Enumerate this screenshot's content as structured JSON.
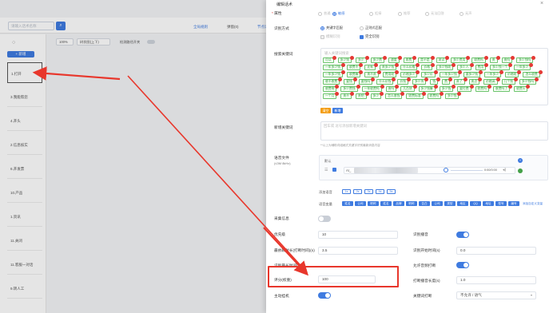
{
  "background": {
    "search_placeholder": "请输入话术名称",
    "tabs": [
      "全局规则",
      "弹窗(0)",
      "节点话术"
    ],
    "add_button": "+ 新增",
    "toolbar": {
      "zoom": "100%",
      "layout": "树状图(上下)",
      "route_label": "检测路径开关"
    },
    "nodes": [
      "1.打开",
      "3.我能帮您",
      "4.开头",
      "2.信息核实",
      "6.开发票",
      "10.产品",
      "1.资讯",
      "11.关闭",
      "11.客服一对话",
      "9.转人工"
    ]
  },
  "drawer": {
    "title": "编辑话术",
    "attr_label": "属性",
    "attr_options": [
      "普通",
      "敏感",
      "拒接",
      "推荐",
      "无法回答",
      "无声"
    ],
    "recog_label": "识别方式",
    "recog_options": [
      "关键字匹配",
      "正则式匹配"
    ],
    "recog_sub_options": [
      "模糊识别",
      "完全识别"
    ],
    "keywords_label": "搜索关键词",
    "keywords_placeholder": "输入关键词搜索",
    "keywords": [
      "可以",
      "多少钱",
      "多少",
      "多少费",
      "速度",
      "收费",
      "是不是",
      "测试",
      "多少费用",
      "收费吗",
      "贵",
      "贵吗",
      "多少钱吗",
      "一年多少钱",
      "收费不",
      "还有",
      "贵多少钱",
      "什么价格",
      "价格",
      "多少钱呢",
      "多少人",
      "费用",
      "多少钱一个",
      "一年多少",
      "一年多少钱",
      "收费嘛",
      "贵不贵",
      "费用呢",
      "价格多少",
      "多少价",
      "一年多少钱",
      "要多少钱",
      "一年多少",
      "价格呢",
      "怎么收费",
      "收不收费",
      "要钱",
      "要钱吗",
      "什么价钱",
      "价钱",
      "多少块",
      "钱",
      "费",
      "贵了",
      "贵点",
      "价格高",
      "几个钱",
      "多少钱吗",
      "收费啊",
      "多少费钱",
      "一年收费吗",
      "贵吗",
      "几百块",
      "多少钱嘛",
      "多少钱",
      "要付费",
      "收费吗",
      "收费吗了",
      "收费么",
      "一个月",
      "贵不",
      "贵吧",
      "多少",
      "怎么收钱",
      "收费标准",
      "收费吗",
      "多少钱"
    ],
    "btn_clear": "清空",
    "btn_add": "新增",
    "new_kw_label": "新增关键词",
    "new_kw_placeholder": "回车或 逗号添加新增关键词",
    "hint": "**以上为辅助词组格式关键字识别最新消息内容",
    "voice_label": "语音文件",
    "voice_sublabel": "(≤3M 8kHz)",
    "voice_default": "默认",
    "voice_file": "AI_",
    "voice_time": "0:00/0:00",
    "add_voice_label": "添加语音",
    "voice_pills": [
      "1s",
      "2s",
      "3s",
      "4s",
      "5s"
    ],
    "voice_vars_label": "语音变量",
    "voice_vars": [
      "姓名",
      "公司",
      "职称",
      "姓名",
      "品牌",
      "职称",
      "告白",
      "公司",
      "类型",
      "地区",
      "QQ",
      "地址",
      "型号",
      "编号"
    ],
    "voice_vars_link": "添加自定义变量",
    "collect_label": "采集信息",
    "collect_on": false,
    "left_fields": [
      {
        "label": "优先级",
        "value": "10"
      },
      {
        "label": "最依赖时长(打断时间)(s)",
        "value": "3.5"
      },
      {
        "label": "识别最长时间(s)",
        "value": ""
      },
      {
        "label": "评分(权重)",
        "value": "100"
      },
      {
        "label": "主动挂机",
        "value": ""
      }
    ],
    "right_fields": [
      {
        "label": "识别播音",
        "value": ""
      },
      {
        "label": "识别开始时间(s)",
        "value": "0.0"
      },
      {
        "label": "允许音频打断",
        "value": ""
      },
      {
        "label": "打断播音长度(s)",
        "value": "1.0"
      },
      {
        "label": "关键词打断",
        "value": "不允许 / 语气"
      }
    ]
  },
  "colors": {
    "accent": "#3f7be0",
    "highlight": "#e8372c",
    "tag_green": "#2e9e3a"
  }
}
